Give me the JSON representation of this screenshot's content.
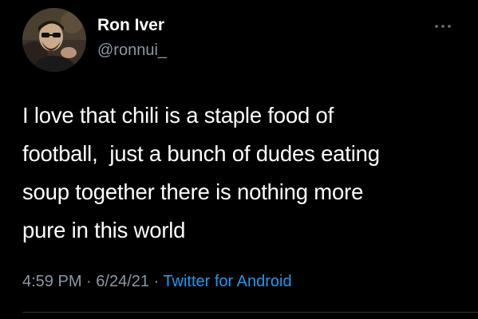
{
  "user": {
    "display_name": "Ron Iver",
    "handle": "@ronnui_"
  },
  "tweet": {
    "lines": [
      "I love that chili is a staple food of",
      "football,  just a bunch of dudes eating",
      "soup together there is nothing more",
      "pure in this world"
    ]
  },
  "meta": {
    "time": "4:59 PM",
    "separator1": " · ",
    "date": "6/24/21",
    "separator2": " · ",
    "source": "Twitter for Android"
  },
  "icons": {
    "more": "more-horizontal-icon",
    "avatar": "avatar"
  },
  "colors": {
    "background": "#000000",
    "primary_text": "#ffffff",
    "secondary_text": "#8b98a5",
    "link": "#1d9bf0"
  }
}
